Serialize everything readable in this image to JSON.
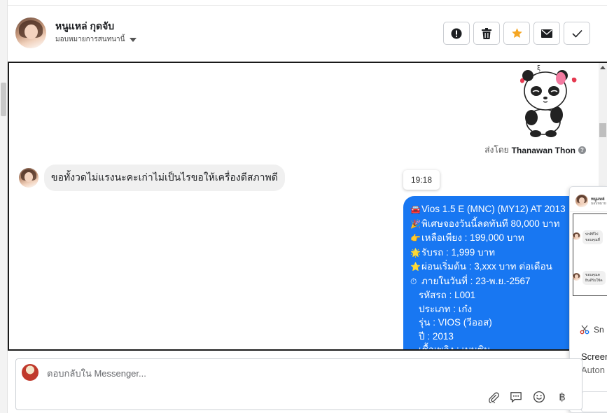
{
  "header": {
    "contact_name": "หนูแหล่ กุดจับ",
    "assign_label": "มอบหมายการสนทนานี้",
    "actions": [
      {
        "icon": "alert-icon",
        "name": "mark-spam-button"
      },
      {
        "icon": "trash-icon",
        "name": "delete-button"
      },
      {
        "icon": "star-icon",
        "name": "star-button"
      },
      {
        "icon": "mail-icon",
        "name": "mark-unread-button"
      },
      {
        "icon": "check-icon",
        "name": "done-button"
      }
    ],
    "star_color": "#f5a623"
  },
  "chat": {
    "sent_by_prefix": "ส่งโดย",
    "sent_by_name": "Thanawan Thon",
    "info_glyph": "?",
    "incoming_message": "ขอทั้งวดไม่แรงนะคะเก่าไม่เป็นไรขอให้เครื่องดีสภาพดี",
    "timestamp": "19:18",
    "outgoing_color": "#1877f2",
    "outgoing_lines": [
      {
        "icon": "🚘",
        "text": "Vios 1.5 E (MNC) (MY12) AT 2013"
      },
      {
        "icon": "🎉",
        "text": "พิเศษจองวันนี้ลดทันที 80,000 บาท"
      },
      {
        "icon": "👉",
        "text": "เหลือเพียง : 199,000 บาท"
      },
      {
        "icon": "🌟",
        "text": "รับรถ : 1,999 บาท"
      },
      {
        "icon": "⭐",
        "text": "ผ่อนเริ่มต้น : 3,xxx บาท ต่อเดือน"
      },
      {
        "icon": "⏱",
        "text": "ภายในวันที่ : 23-พ.ย.-2567"
      },
      {
        "icon": "",
        "text": "รหัสรถ : L001"
      },
      {
        "icon": "",
        "text": "ประเภท : เก๋ง"
      },
      {
        "icon": "",
        "text": "รุ่น : VIOS (วีออส)"
      },
      {
        "icon": "",
        "text": "ปี : 2013"
      },
      {
        "icon": "",
        "text": "เชื้อเพลิง : เบนซิน"
      }
    ]
  },
  "overlay": {
    "mini_name": "หนูแหล่",
    "mini_sub": "มอบหมาย",
    "mini_msg1_line1": "ปกติที่ไป",
    "mini_msg1_line2": "ขอบคุณที่",
    "mini_msg2_line1": "ขอบคุณค",
    "mini_msg2_line2": "ยินดีรับใช้ค",
    "tool_label": "Sn",
    "text1": "Screen",
    "text2": "Auton"
  },
  "composer": {
    "placeholder": "ตอบกลับใน Messenger...",
    "tools": [
      "paperclip-icon",
      "saved-reply-icon",
      "emoji-icon",
      "baht-icon"
    ],
    "baht_glyph": "฿"
  }
}
